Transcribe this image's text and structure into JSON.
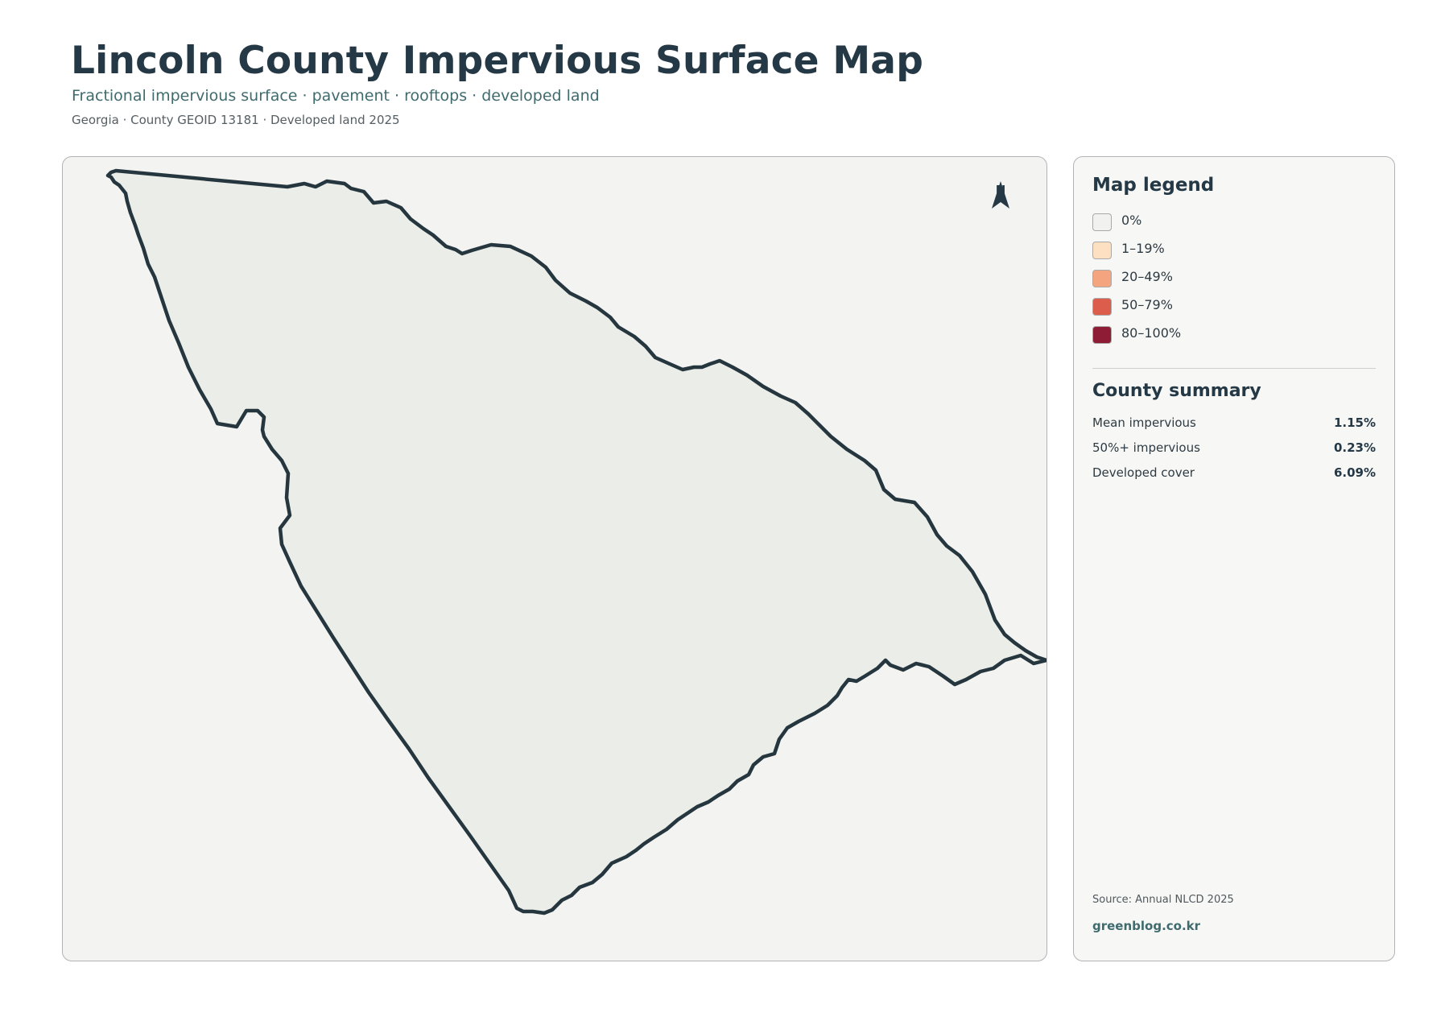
{
  "header": {
    "title": "Lincoln County Impervious Surface Map",
    "subtitle": "Fractional impervious surface · pavement · rooftops · developed land",
    "meta": "Georgia · County GEOID 13181 · Developed land 2025"
  },
  "map": {
    "north_label": "N",
    "north_icon": "north-arrow-icon",
    "fill_color": "#ebede8",
    "boundary_color": "#25363f"
  },
  "legend": {
    "title": "Map legend",
    "items": [
      {
        "label": "0%",
        "color": "#f1f1ef"
      },
      {
        "label": "1–19%",
        "color": "#fde0c1"
      },
      {
        "label": "20–49%",
        "color": "#f4a57f"
      },
      {
        "label": "50–79%",
        "color": "#dc5d4b"
      },
      {
        "label": "80–100%",
        "color": "#8e1c34"
      }
    ]
  },
  "summary": {
    "title": "County summary",
    "rows": [
      {
        "label": "Mean impervious",
        "value": "1.15%"
      },
      {
        "label": "50%+ impervious",
        "value": "0.23%"
      },
      {
        "label": "Developed cover",
        "value": "6.09%"
      }
    ]
  },
  "footer": {
    "source": "Source: Annual NLCD 2025",
    "site": "greenblog.co.kr"
  }
}
